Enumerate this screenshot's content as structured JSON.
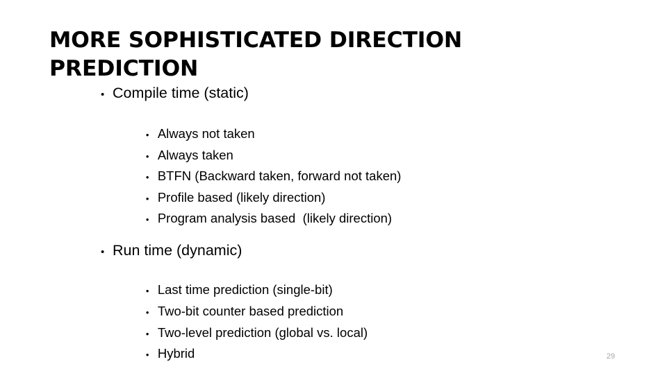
{
  "slide": {
    "title": "MORE SOPHISTICATED DIRECTION PREDICTION",
    "page_number": "29",
    "text_color": "#000000",
    "page_number_color": "#a6a6a6",
    "background_color": "#ffffff",
    "bullet_glyph": "•"
  },
  "content": {
    "sections": [
      {
        "heading": "Compile time (static)",
        "items": [
          "Always not taken",
          "Always taken",
          "BTFN (Backward taken, forward not taken)",
          "Profile based (likely direction)",
          "Program analysis based  (likely direction)"
        ]
      },
      {
        "heading": "Run time (dynamic)",
        "items": [
          "Last time prediction (single-bit)",
          "Two-bit counter based prediction",
          "Two-level prediction (global vs. local)",
          "Hybrid"
        ]
      }
    ]
  }
}
